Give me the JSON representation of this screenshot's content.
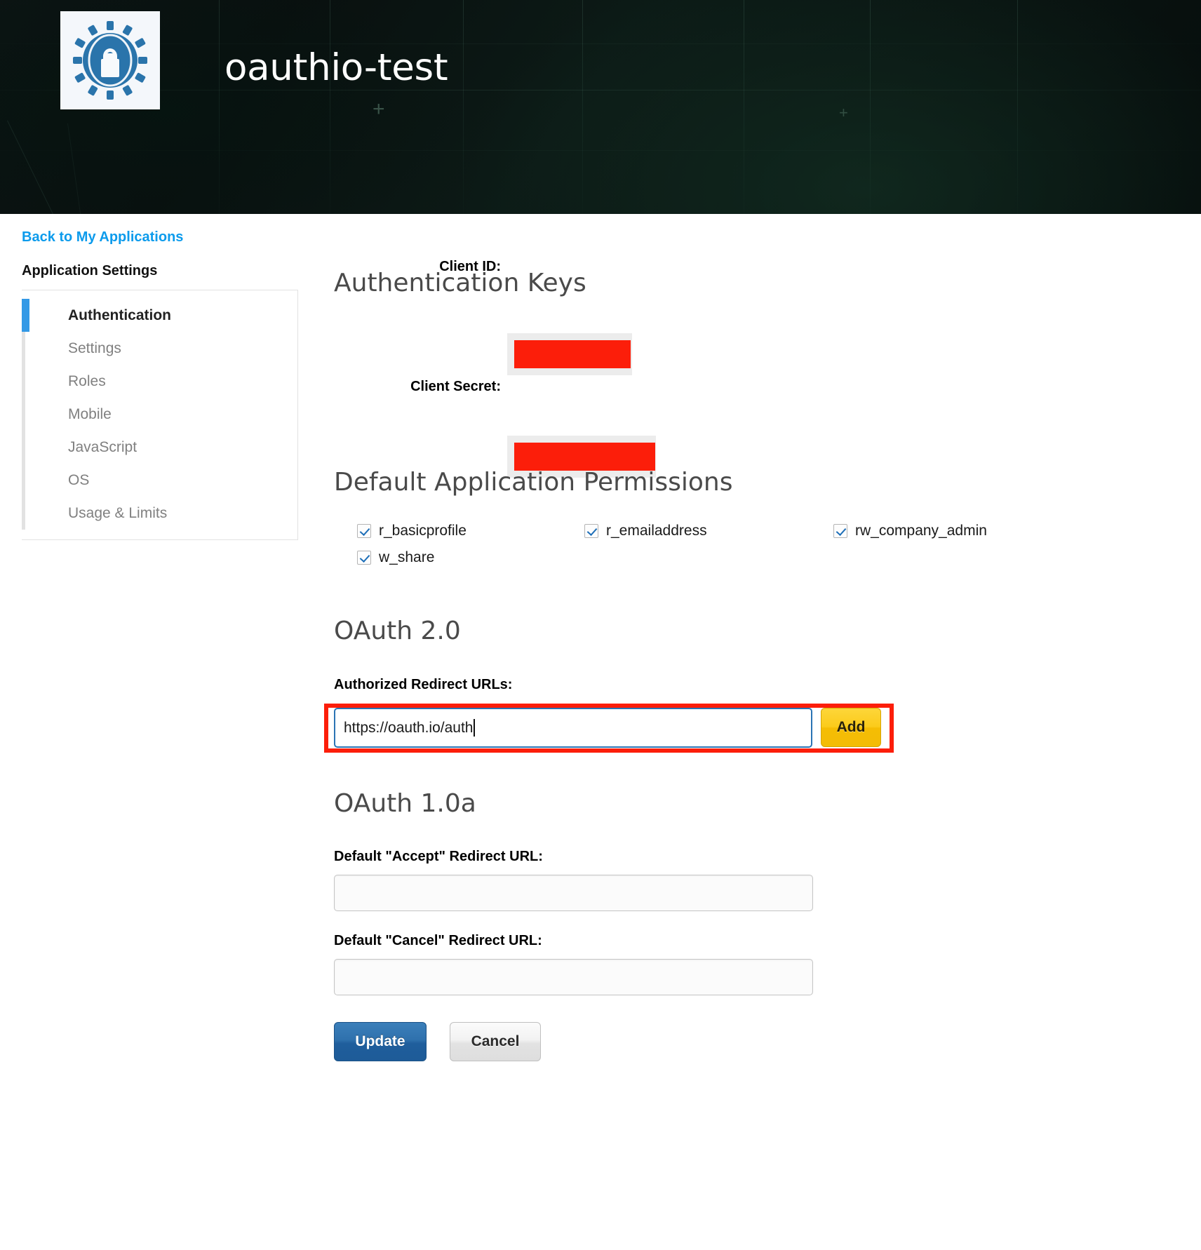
{
  "header": {
    "app_title": "oauthio-test",
    "logo_icon": "gear-lock-icon"
  },
  "sidebar": {
    "back_link": "Back to My Applications",
    "settings_heading": "Application Settings",
    "items": [
      {
        "label": "Authentication",
        "active": true
      },
      {
        "label": "Settings",
        "active": false
      },
      {
        "label": "Roles",
        "active": false
      },
      {
        "label": "Mobile",
        "active": false
      },
      {
        "label": "JavaScript",
        "active": false
      },
      {
        "label": "OS",
        "active": false
      },
      {
        "label": "Usage & Limits",
        "active": false
      }
    ]
  },
  "auth_keys": {
    "title": "Authentication Keys",
    "rows": [
      {
        "label": "Client ID:",
        "value": "",
        "redacted": true
      },
      {
        "label": "Client Secret:",
        "value": "",
        "redacted": true
      }
    ]
  },
  "permissions": {
    "title": "Default Application Permissions",
    "items": [
      {
        "label": "r_basicprofile",
        "checked": true
      },
      {
        "label": "r_emailaddress",
        "checked": true
      },
      {
        "label": "rw_company_admin",
        "checked": true
      },
      {
        "label": "w_share",
        "checked": true
      }
    ]
  },
  "oauth2": {
    "title": "OAuth 2.0",
    "redirect_label": "Authorized Redirect URLs:",
    "redirect_value": "https://oauth.io/auth",
    "add_label": "Add"
  },
  "oauth1": {
    "title": "OAuth 1.0a",
    "accept_label": "Default \"Accept\" Redirect URL:",
    "accept_value": "",
    "cancel_label": "Default \"Cancel\" Redirect URL:",
    "cancel_value": ""
  },
  "actions": {
    "update_label": "Update",
    "cancel_label": "Cancel"
  },
  "colors": {
    "link_blue": "#0c9bec",
    "active_rail": "#3399e6",
    "redaction_red": "#fc1e0a",
    "highlight_red": "#fc1e0a",
    "add_yellow": "#fbcb1b",
    "primary_blue": "#2f71ad",
    "checkbox_check": "#1e6fb8"
  }
}
